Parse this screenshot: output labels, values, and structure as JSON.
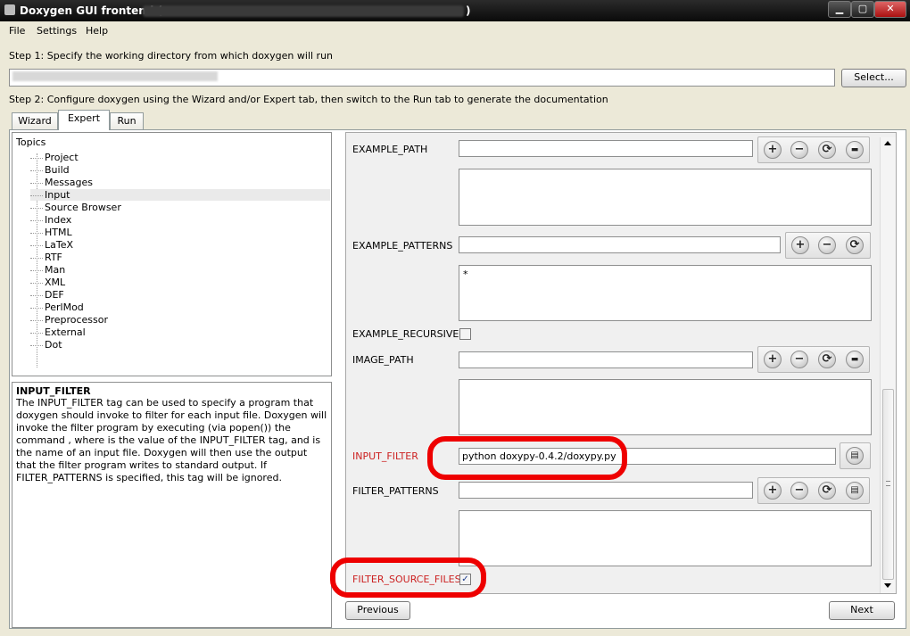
{
  "window": {
    "title": "Doxygen GUI frontend (",
    "title_suffix": ")"
  },
  "menu": {
    "file": "File",
    "settings": "Settings",
    "help": "Help"
  },
  "step1": {
    "label": "Step 1: Specify the working directory from which doxygen will run",
    "select_button": "Select..."
  },
  "step2": {
    "label": "Step 2: Configure doxygen using the Wizard and/or Expert tab, then switch to the Run tab to generate the documentation"
  },
  "tabs": {
    "wizard": "Wizard",
    "expert": "Expert",
    "run": "Run"
  },
  "topics": {
    "header": "Topics",
    "items": [
      "Project",
      "Build",
      "Messages",
      "Input",
      "Source Browser",
      "Index",
      "HTML",
      "LaTeX",
      "RTF",
      "Man",
      "XML",
      "DEF",
      "PerlMod",
      "Preprocessor",
      "External",
      "Dot"
    ],
    "selected": "Input"
  },
  "help": {
    "title": "INPUT_FILTER",
    "body": "The INPUT_FILTER tag can be used to specify a program that doxygen should invoke to filter for each input file. Doxygen will invoke the filter program by executing (via popen()) the command , where is the value of the INPUT_FILTER tag, and is the name of an input file. Doxygen will then use the output that the filter program writes to standard output. If FILTER_PATTERNS is specified, this tag will be ignored."
  },
  "options": {
    "example_path": {
      "label": "EXAMPLE_PATH",
      "value": ""
    },
    "example_patterns": {
      "label": "EXAMPLE_PATTERNS",
      "value": "",
      "list": "*"
    },
    "example_recursive": {
      "label": "EXAMPLE_RECURSIVE",
      "checked": false
    },
    "image_path": {
      "label": "IMAGE_PATH",
      "value": ""
    },
    "input_filter": {
      "label": "INPUT_FILTER",
      "value": "python doxypy-0.4.2/doxypy.py"
    },
    "filter_patterns": {
      "label": "FILTER_PATTERNS",
      "value": ""
    },
    "filter_source_files": {
      "label": "FILTER_SOURCE_FILES",
      "checked": true
    }
  },
  "nav": {
    "previous": "Previous",
    "next": "Next"
  },
  "icons": {
    "add": "+",
    "remove": "−",
    "refresh": "⟳",
    "folder": "▬",
    "file": "▤",
    "check": "✓"
  },
  "colors": {
    "modified_label": "#cc2222",
    "annotation": "#ee0000"
  }
}
